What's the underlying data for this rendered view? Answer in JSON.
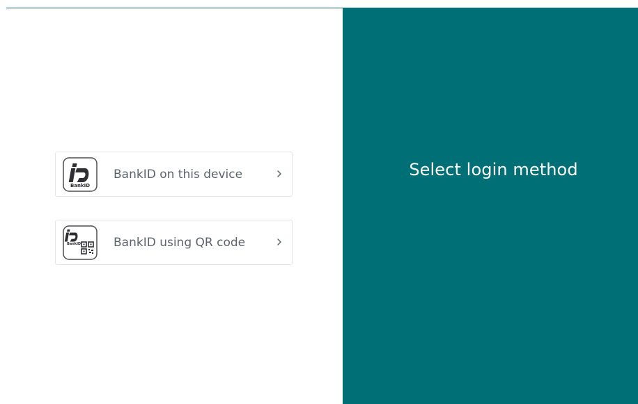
{
  "login_panel": {
    "title": "Select login method"
  },
  "options": [
    {
      "label": "BankID on this device",
      "logo_text": "BankID",
      "icon": "bankid-logo-icon",
      "chevron_icon": "chevron-right-icon"
    },
    {
      "label": "BankID using QR code",
      "logo_text": "BankID",
      "icon": "bankid-qr-logo-icon",
      "chevron_icon": "chevron-right-icon"
    }
  ],
  "colors": {
    "panel_background": "#006f76",
    "panel_text": "#ffffff",
    "option_border": "#e3e6e8",
    "option_text": "#5b6468"
  }
}
